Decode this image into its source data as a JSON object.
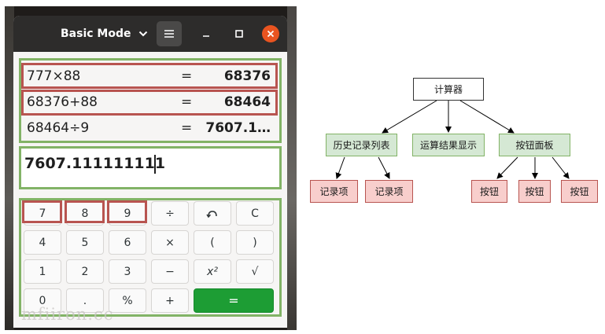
{
  "window": {
    "mode_label": "Basic Mode",
    "menu_icon": "hamburger-menu-icon",
    "controls": [
      "minimize-icon",
      "maximize-icon",
      "close-icon"
    ],
    "close_color": "#e95420"
  },
  "history": [
    {
      "expr": "777×88",
      "eq": "=",
      "result": "68376"
    },
    {
      "expr": "68376+88",
      "eq": "=",
      "result": "68464"
    },
    {
      "expr": "68464÷9",
      "eq": "=",
      "result": "7607.1…"
    }
  ],
  "display": {
    "value": "7607.111111111"
  },
  "keypad": {
    "rows": [
      [
        "7",
        "8",
        "9",
        "÷",
        "↶",
        "C"
      ],
      [
        "4",
        "5",
        "6",
        "×",
        "(",
        ")"
      ],
      [
        "1",
        "2",
        "3",
        "−",
        "x²",
        "√"
      ],
      [
        "0",
        ".",
        "%",
        "+",
        "="
      ]
    ],
    "equals_color": "#1d9d34"
  },
  "watermark": "mfiiron.cc",
  "highlight_colors": {
    "green": "#82b366",
    "red": "#b85450"
  },
  "diagram": {
    "root": "计算器",
    "children": [
      "历史记录列表",
      "运算结果显示",
      "按钮面板"
    ],
    "history_children": [
      "记录项",
      "记录项"
    ],
    "button_children": [
      "按钮",
      "按钮",
      "按钮"
    ]
  }
}
